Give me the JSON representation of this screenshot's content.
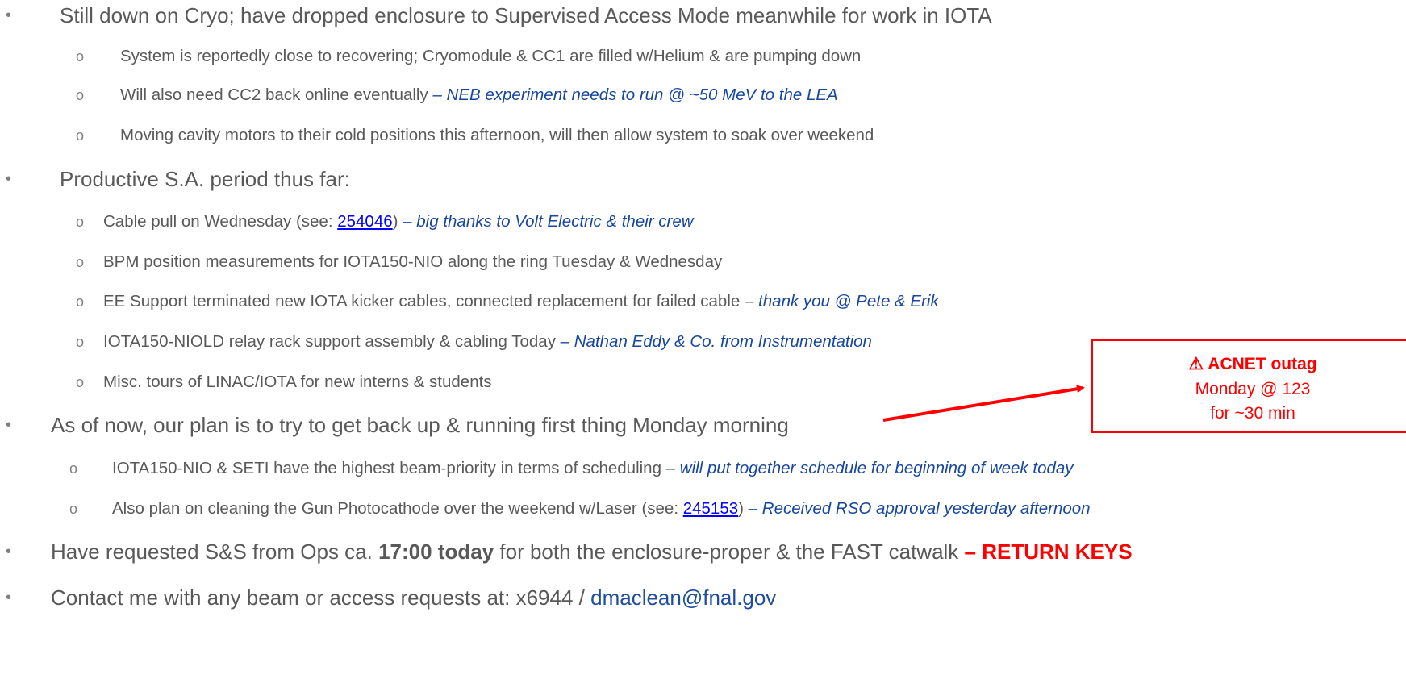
{
  "bullets": {
    "l1": {
      "marker": "•",
      "text": "Still down on Cryo; have dropped enclosure to Supervised Access Mode meanwhile for work in IOTA"
    },
    "l1a": {
      "marker": "o",
      "text": "System is reportedly close to recovering; Cryomodule & CC1 are filled w/Helium & are pumping down"
    },
    "l1b": {
      "marker": "o",
      "text": "Will also need CC2 back online eventually ",
      "note": "– NEB experiment needs to run @ ~50 MeV to the LEA"
    },
    "l1c": {
      "marker": "o",
      "text": "Moving cavity motors to their cold positions this afternoon, will then allow system to soak over weekend"
    },
    "l2": {
      "marker": "•",
      "text": "Productive S.A. period thus far:"
    },
    "l2a": {
      "marker": "o",
      "text_pre": "Cable pull on Wednesday (see: ",
      "link": "254046",
      "text_post": ") ",
      "note": "– big thanks to Volt Electric & their crew"
    },
    "l2b": {
      "marker": "o",
      "text": "BPM position measurements for IOTA150-NIO along the ring Tuesday & Wednesday"
    },
    "l2c": {
      "marker": "o",
      "text": "EE Support terminated new IOTA kicker cables, connected replacement for failed cable – ",
      "note": "thank you @ Pete & Erik"
    },
    "l2d": {
      "marker": "o",
      "text": "IOTA150-NIOLD relay rack support assembly & cabling Today ",
      "note": "– Nathan Eddy & Co. from Instrumentation"
    },
    "l2e": {
      "marker": "o",
      "text": "Misc. tours of LINAC/IOTA for new interns & students"
    },
    "l3": {
      "marker": "•",
      "text": "As of now, our plan is to try to get back up & running first thing Monday morning"
    },
    "l3a": {
      "marker": "o",
      "text": "IOTA150-NIO & SETI have the highest beam-priority in terms of scheduling ",
      "note": "– will put together schedule for beginning of week today"
    },
    "l3b": {
      "marker": "o",
      "text_pre": "Also plan on cleaning the Gun Photocathode over the weekend w/Laser (see: ",
      "link": "245153",
      "text_post": ") ",
      "note": "– Received RSO approval yesterday afternoon"
    },
    "l4": {
      "marker": "•",
      "text_pre": "Have requested S&S from Ops ca. ",
      "strong": "17:00 today",
      "text_mid": " for both the enclosure-proper & the FAST catwalk ",
      "red": "– RETURN KEYS"
    },
    "l5": {
      "marker": "•",
      "text_pre": "Contact me with any beam or access requests at: x6944 / ",
      "email": "dmaclean@fnal.gov"
    }
  },
  "callout": {
    "icon": "⚠",
    "title": "ACNET outag",
    "line2": "Monday @ 123",
    "line3": "for ~30 min"
  },
  "colors": {
    "accent_red": "#ff0000",
    "note_blue": "#17469e",
    "body_gray": "#595959"
  }
}
